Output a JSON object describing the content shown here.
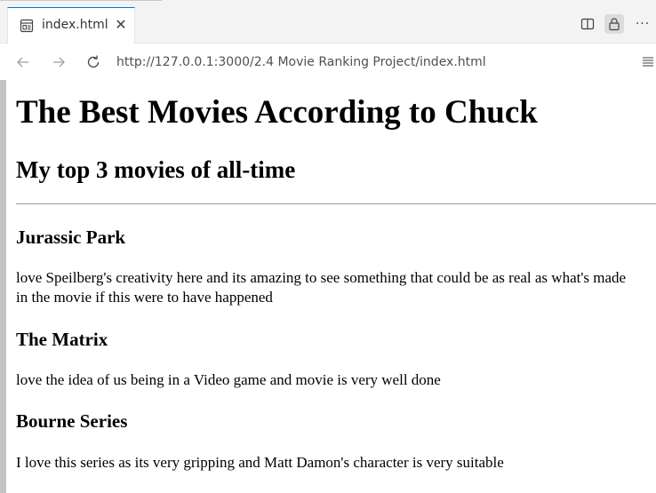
{
  "browser": {
    "tab": {
      "title": "index.html",
      "close_glyph": "✕",
      "icon": "preview-icon"
    },
    "actions": {
      "split_icon": "split-editor-icon",
      "lock_icon": "lock-icon",
      "more_label": "···"
    },
    "nav": {
      "back_icon": "arrow-left-icon",
      "forward_icon": "arrow-right-icon",
      "reload_icon": "reload-icon",
      "url": "http://127.0.0.1:3000/2.4 Movie Ranking Project/index.html",
      "menu_icon": "menu-icon"
    }
  },
  "page": {
    "heading": "The Best Movies According to Chuck",
    "subheading": "My top 3 movies of all-time",
    "movies": [
      {
        "title": "Jurassic Park",
        "description": "love Speilberg's creativity here and its amazing to see something that could be as real as what's made in the movie if this were to have happened"
      },
      {
        "title": "The Matrix",
        "description": "love the idea of us being in a Video game and movie is very well done"
      },
      {
        "title": "Bourne Series",
        "description": "I love this series as its very gripping and Matt Damon's character is very suitable"
      }
    ]
  },
  "colors": {
    "tab_accent": "#0078d4",
    "chrome_bg": "#f3f3f3",
    "lock_active_bg": "#dcdcdc",
    "page_text": "#000000"
  }
}
